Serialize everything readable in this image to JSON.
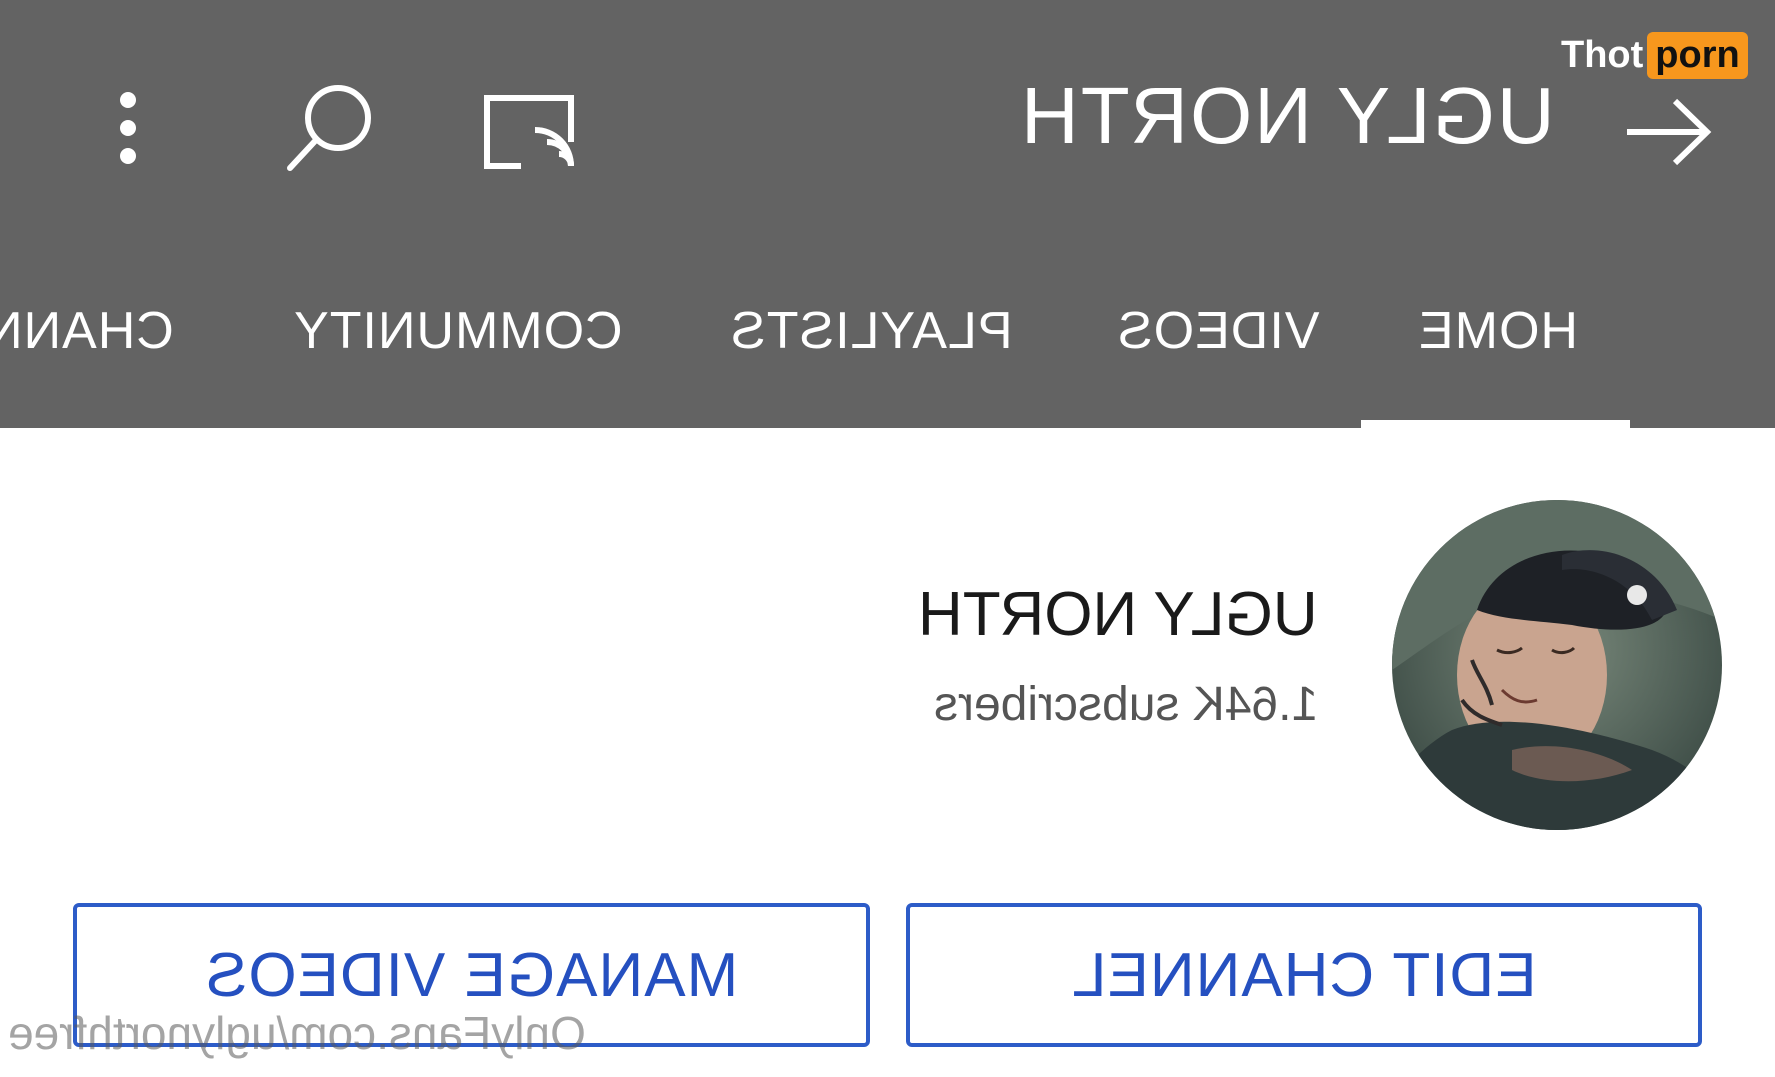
{
  "header": {
    "channel_title": "UGLY NORTH",
    "icons": {
      "more": "more-vert-icon",
      "search": "search-icon",
      "cast": "cast-icon",
      "forward": "arrow-forward-icon"
    },
    "background_color": "#636363"
  },
  "tabs": [
    {
      "label": "HOME",
      "selected": true
    },
    {
      "label": "VIDEOS",
      "selected": false
    },
    {
      "label": "PLAYLISTS",
      "selected": false
    },
    {
      "label": "COMMUNITY",
      "selected": false
    },
    {
      "label": "CHANN",
      "selected": false
    }
  ],
  "profile": {
    "name": "UGLY NORTH",
    "subscribers": "1.64K subscribers"
  },
  "actions": {
    "edit_channel": "EDIT CHANNEL",
    "manage_videos": "MANAGE VIDEOS",
    "accent_color": "#2550c0"
  },
  "watermarks": {
    "brand_part1": "Thot",
    "brand_part2": "porn",
    "url": "OnlyFans.com/uglynorthfree"
  },
  "display": {
    "mirrored_horizontally": true
  }
}
